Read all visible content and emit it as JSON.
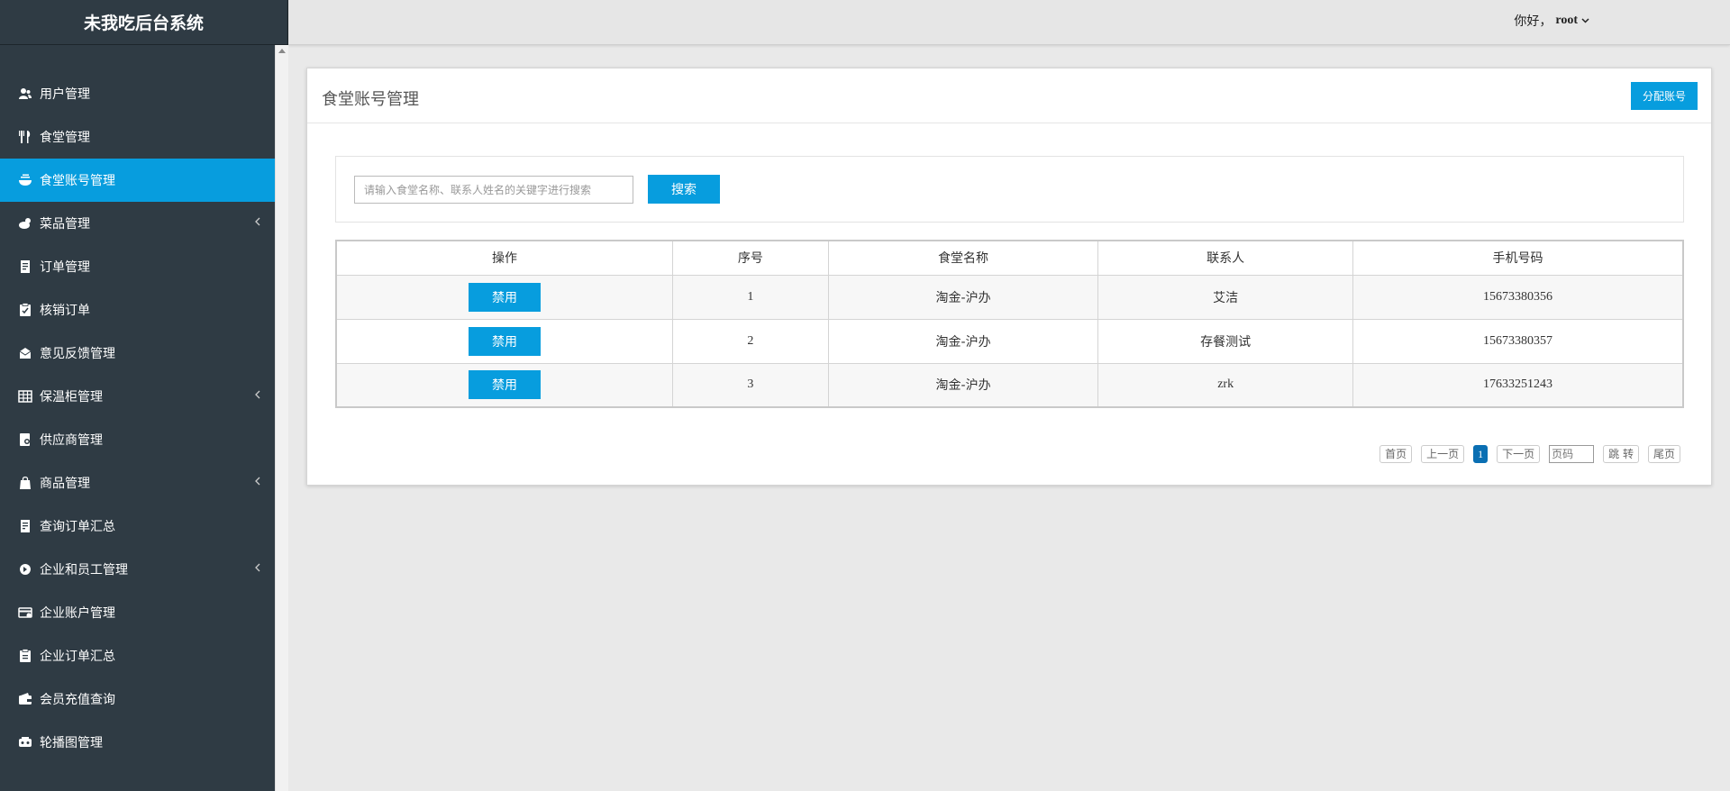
{
  "app": {
    "title": "未我吃后台系统"
  },
  "header": {
    "greeting": "你好，",
    "username": "root"
  },
  "sidebar": {
    "items": [
      {
        "label": "用户管理",
        "icon": "users-icon",
        "active": false,
        "expandable": false
      },
      {
        "label": "食堂管理",
        "icon": "cutlery-icon",
        "active": false,
        "expandable": false
      },
      {
        "label": "食堂账号管理",
        "icon": "bowl-icon",
        "active": true,
        "expandable": false
      },
      {
        "label": "菜品管理",
        "icon": "food-icon",
        "active": false,
        "expandable": true
      },
      {
        "label": "订单管理",
        "icon": "receipt-icon",
        "active": false,
        "expandable": false
      },
      {
        "label": "核销订单",
        "icon": "clipboard-check-icon",
        "active": false,
        "expandable": false
      },
      {
        "label": "意见反馈管理",
        "icon": "mailbox-icon",
        "active": false,
        "expandable": false
      },
      {
        "label": "保温柜管理",
        "icon": "grid-icon",
        "active": false,
        "expandable": true
      },
      {
        "label": "供应商管理",
        "icon": "supplier-icon",
        "active": false,
        "expandable": false
      },
      {
        "label": "商品管理",
        "icon": "bag-icon",
        "active": false,
        "expandable": true
      },
      {
        "label": "查询订单汇总",
        "icon": "document-icon",
        "active": false,
        "expandable": false
      },
      {
        "label": "企业和员工管理",
        "icon": "company-icon",
        "active": false,
        "expandable": true
      },
      {
        "label": "企业账户管理",
        "icon": "wallet-card-icon",
        "active": false,
        "expandable": false
      },
      {
        "label": "企业订单汇总",
        "icon": "clipboard-icon",
        "active": false,
        "expandable": false
      },
      {
        "label": "会员充值查询",
        "icon": "wallet-icon",
        "active": false,
        "expandable": false
      },
      {
        "label": "轮播图管理",
        "icon": "images-icon",
        "active": false,
        "expandable": false
      }
    ]
  },
  "main": {
    "title": "食堂账号管理",
    "assign_label": "分配账号",
    "search": {
      "placeholder": "请输入食堂名称、联系人姓名的关键字进行搜索",
      "value": "",
      "button_label": "搜索"
    },
    "table": {
      "headers": [
        "操作",
        "序号",
        "食堂名称",
        "联系人",
        "手机号码"
      ],
      "rows": [
        {
          "action": "禁用",
          "index": "1",
          "canteen": "淘金-沪办",
          "contact": "艾洁",
          "phone": "15673380356"
        },
        {
          "action": "禁用",
          "index": "2",
          "canteen": "淘金-沪办",
          "contact": "存餐测试",
          "phone": "15673380357"
        },
        {
          "action": "禁用",
          "index": "3",
          "canteen": "淘金-沪办",
          "contact": "zrk",
          "phone": "17633251243"
        }
      ]
    },
    "pagination": {
      "first": "首页",
      "prev": "上一页",
      "current": "1",
      "next": "下一页",
      "page_placeholder": "页码",
      "jump": "跳 转",
      "last": "尾页"
    }
  },
  "colors": {
    "sidebar_bg": "#2f3b44",
    "accent": "#079dde",
    "pager_current": "#0a6fb3"
  }
}
